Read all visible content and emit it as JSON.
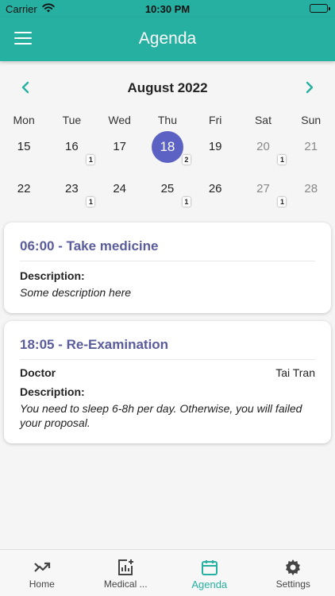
{
  "status": {
    "carrier": "Carrier",
    "time": "10:30 PM"
  },
  "app_bar": {
    "title": "Agenda"
  },
  "calendar": {
    "month": "August 2022",
    "weekdays": [
      "Mon",
      "Tue",
      "Wed",
      "Thu",
      "Fri",
      "Sat",
      "Sun"
    ],
    "weeks": [
      [
        {
          "day": "15",
          "badge": ""
        },
        {
          "day": "16",
          "badge": "1"
        },
        {
          "day": "17",
          "badge": ""
        },
        {
          "day": "18",
          "badge": "2",
          "selected": true
        },
        {
          "day": "19",
          "badge": ""
        },
        {
          "day": "20",
          "badge": "1",
          "muted": true
        },
        {
          "day": "21",
          "badge": "",
          "muted": true
        }
      ],
      [
        {
          "day": "22",
          "badge": ""
        },
        {
          "day": "23",
          "badge": "1"
        },
        {
          "day": "24",
          "badge": ""
        },
        {
          "day": "25",
          "badge": "1"
        },
        {
          "day": "26",
          "badge": ""
        },
        {
          "day": "27",
          "badge": "1",
          "muted": true
        },
        {
          "day": "28",
          "badge": "",
          "muted": true
        }
      ]
    ]
  },
  "events": [
    {
      "title": "06:00 - Take medicine",
      "description_label": "Description:",
      "description": "Some description here"
    },
    {
      "title": "18:05 - Re-Examination",
      "doctor_label": "Doctor",
      "doctor_name": "Tai Tran",
      "description_label": "Description:",
      "description": "You need to sleep 6-8h per day. Otherwise, you will failed your proposal."
    }
  ],
  "bottom_nav": {
    "items": [
      {
        "label": "Home",
        "icon": "trending-icon"
      },
      {
        "label": "Medical ...",
        "icon": "medical-chart-icon"
      },
      {
        "label": "Agenda",
        "icon": "calendar-icon",
        "active": true
      },
      {
        "label": "Settings",
        "icon": "gear-icon"
      }
    ]
  },
  "colors": {
    "primary": "#26b0a1",
    "selected_day": "#5c62c4",
    "event_title": "#5a5c9c"
  }
}
